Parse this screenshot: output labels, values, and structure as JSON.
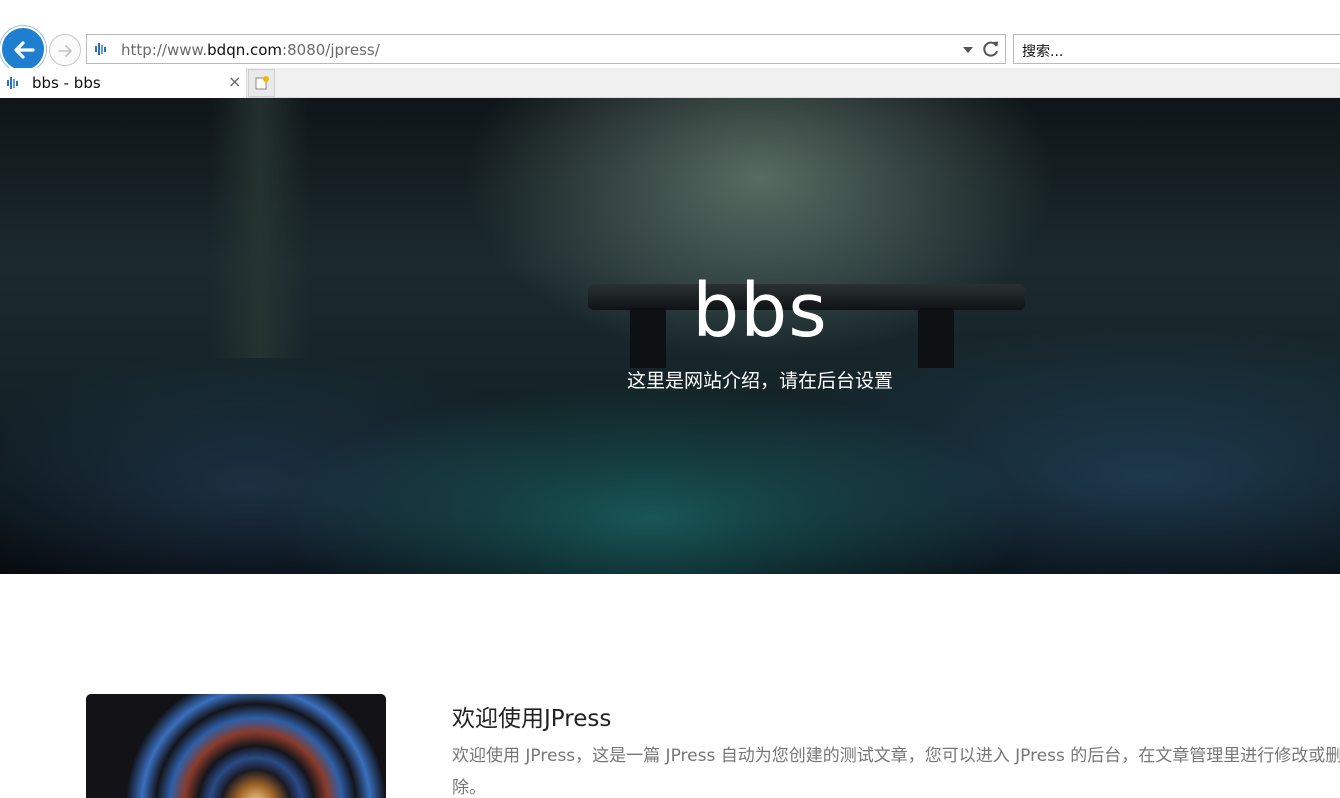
{
  "browser": {
    "url_prefix": "http://www.",
    "url_domain": "bdqn.com",
    "url_suffix": ":8080/jpress/",
    "search_placeholder": "搜索...",
    "tab_title": "bbs - bbs",
    "tab_close": "×"
  },
  "hero": {
    "title": "bbs",
    "subtitle": "这里是网站介绍，请在后台设置"
  },
  "post": {
    "title": "欢迎使用JPress",
    "excerpt": "欢迎使用 JPress，这是一篇 JPress 自动为您创建的测试文章，您可以进入 JPress 的后台，在文章管理里进行修改或删除。"
  },
  "icons": {
    "back": "back-arrow-icon",
    "forward": "forward-arrow-icon",
    "favicon": "site-favicon-icon",
    "dropdown": "dropdown-arrow-icon",
    "refresh": "refresh-icon",
    "new_tab": "new-tab-icon"
  },
  "colors": {
    "back_button": "#1e7fd1",
    "hero_text": "#ffffff",
    "excerpt_text": "#777777"
  }
}
